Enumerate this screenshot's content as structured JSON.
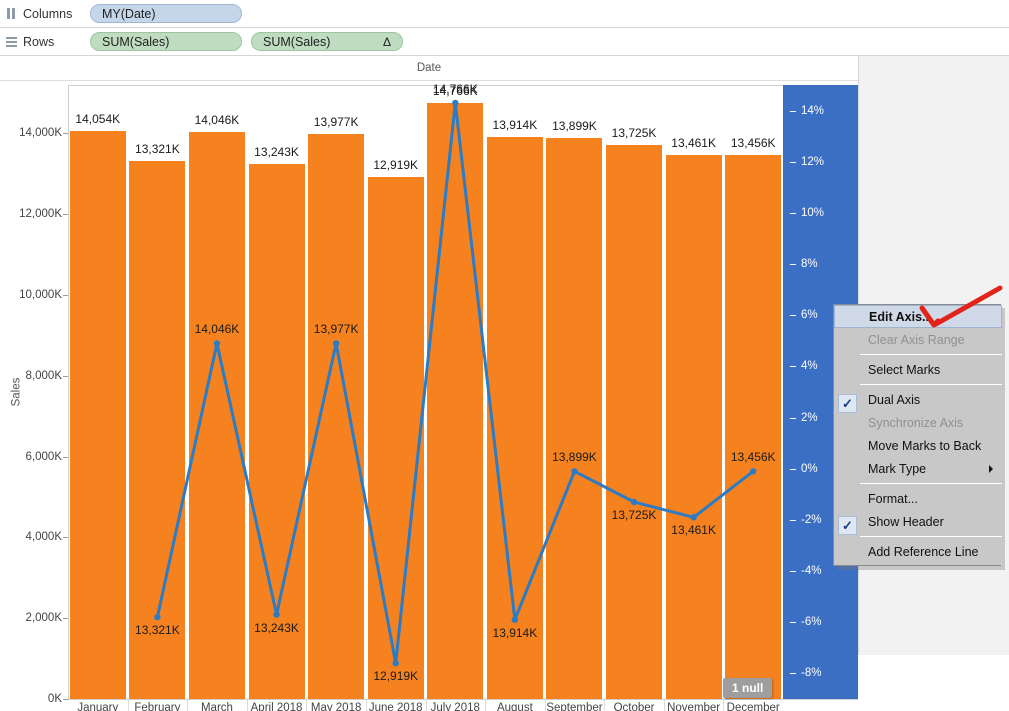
{
  "shelves": {
    "columns": {
      "label": "Columns",
      "grip_icon": "columns-grip-icon",
      "pills": [
        {
          "text": "MY(Date)",
          "extra": ""
        }
      ]
    },
    "rows": {
      "label": "Rows",
      "grip_icon": "rows-grip-icon",
      "pills": [
        {
          "text": "SUM(Sales)",
          "extra": ""
        },
        {
          "text": "SUM(Sales)",
          "extra": "Δ"
        }
      ]
    }
  },
  "view": {
    "column_header": "Date",
    "y_axis_title": "Sales",
    "null_badge": "1 null"
  },
  "chart_data": {
    "type": "bar",
    "title": "Date",
    "xlabel": "",
    "ylabel": "Sales",
    "grid": false,
    "legend": "none",
    "categories": [
      "January 2018",
      "February 2018",
      "March 2018",
      "April 2018",
      "May 2018",
      "June 2018",
      "July 2018",
      "August 2018",
      "September 2018",
      "October 2018",
      "November 2018",
      "December 2018"
    ],
    "tick_labels_visible": [
      "January",
      "February",
      "March",
      "April 2018",
      "May 2018",
      "June 2018",
      "July 2018",
      "August",
      "September",
      "October",
      "November",
      "December"
    ],
    "left_axis": {
      "ticks": [
        "0K",
        "2,000K",
        "4,000K",
        "6,000K",
        "8,000K",
        "10,000K",
        "12,000K",
        "14,000K"
      ],
      "tick_values": [
        0,
        2000,
        4000,
        6000,
        8000,
        10000,
        12000,
        14000
      ],
      "ylim": [
        0,
        15200
      ],
      "unit": "K"
    },
    "right_axis": {
      "ticks": [
        "-8%",
        "-6%",
        "-4%",
        "-2%",
        "0%",
        "2%",
        "4%",
        "6%",
        "8%",
        "10%",
        "12%",
        "14%"
      ],
      "tick_values": [
        -8,
        -6,
        -4,
        -2,
        0,
        2,
        4,
        6,
        8,
        10,
        12,
        14
      ],
      "ylim": [
        -9,
        15
      ],
      "selected": true,
      "highlight_color": "#3b6fc4"
    },
    "series": [
      {
        "name": "SUM(Sales)",
        "mark": "bar",
        "color": "#f5821f",
        "labels": [
          "14,054K",
          "13,321K",
          "14,046K",
          "13,243K",
          "13,977K",
          "12,919K",
          "14,766K",
          "13,914K",
          "13,899K",
          "13,725K",
          "13,461K",
          "13,456K"
        ],
        "values": [
          14054,
          13321,
          14046,
          13243,
          13977,
          12919,
          14766,
          13914,
          13899,
          13725,
          13461,
          13456
        ]
      },
      {
        "name": "SUM(Sales) Δ",
        "mark": "line",
        "color": "#2b7cc4",
        "labels": [
          "",
          "13,321K",
          "14,046K",
          "13,243K",
          "13,977K",
          "12,919K",
          "14,766K",
          "13,914K",
          "13,899K",
          "13,725K",
          "13,461K",
          "13,456K"
        ],
        "percent_values": [
          null,
          -5.8,
          4.9,
          -5.7,
          4.9,
          -7.6,
          14.3,
          -5.9,
          -0.1,
          -1.3,
          -1.9,
          -0.1
        ]
      }
    ]
  },
  "context_menu": {
    "items": [
      {
        "label": "Edit Axis...",
        "state": "highlight",
        "check": false,
        "submenu": false
      },
      {
        "label": "Clear Axis Range",
        "state": "disabled",
        "check": false,
        "submenu": false
      },
      {
        "label": "separator"
      },
      {
        "label": "Select Marks",
        "state": "normal",
        "check": false,
        "submenu": false
      },
      {
        "label": "separator"
      },
      {
        "label": "Dual Axis",
        "state": "normal",
        "check": true,
        "submenu": false
      },
      {
        "label": "Synchronize Axis",
        "state": "disabled",
        "check": false,
        "submenu": false
      },
      {
        "label": "Move Marks to Back",
        "state": "normal",
        "check": false,
        "submenu": false
      },
      {
        "label": "Mark Type",
        "state": "normal",
        "check": false,
        "submenu": true
      },
      {
        "label": "separator"
      },
      {
        "label": "Format...",
        "state": "normal",
        "check": false,
        "submenu": false
      },
      {
        "label": "Show Header",
        "state": "normal",
        "check": true,
        "submenu": false
      },
      {
        "label": "separator"
      },
      {
        "label": "Add Reference Line",
        "state": "normal",
        "check": false,
        "submenu": false
      }
    ],
    "check_glyph": "✓"
  },
  "annotation": {
    "name": "red-arrow",
    "color": "#e2231a"
  }
}
